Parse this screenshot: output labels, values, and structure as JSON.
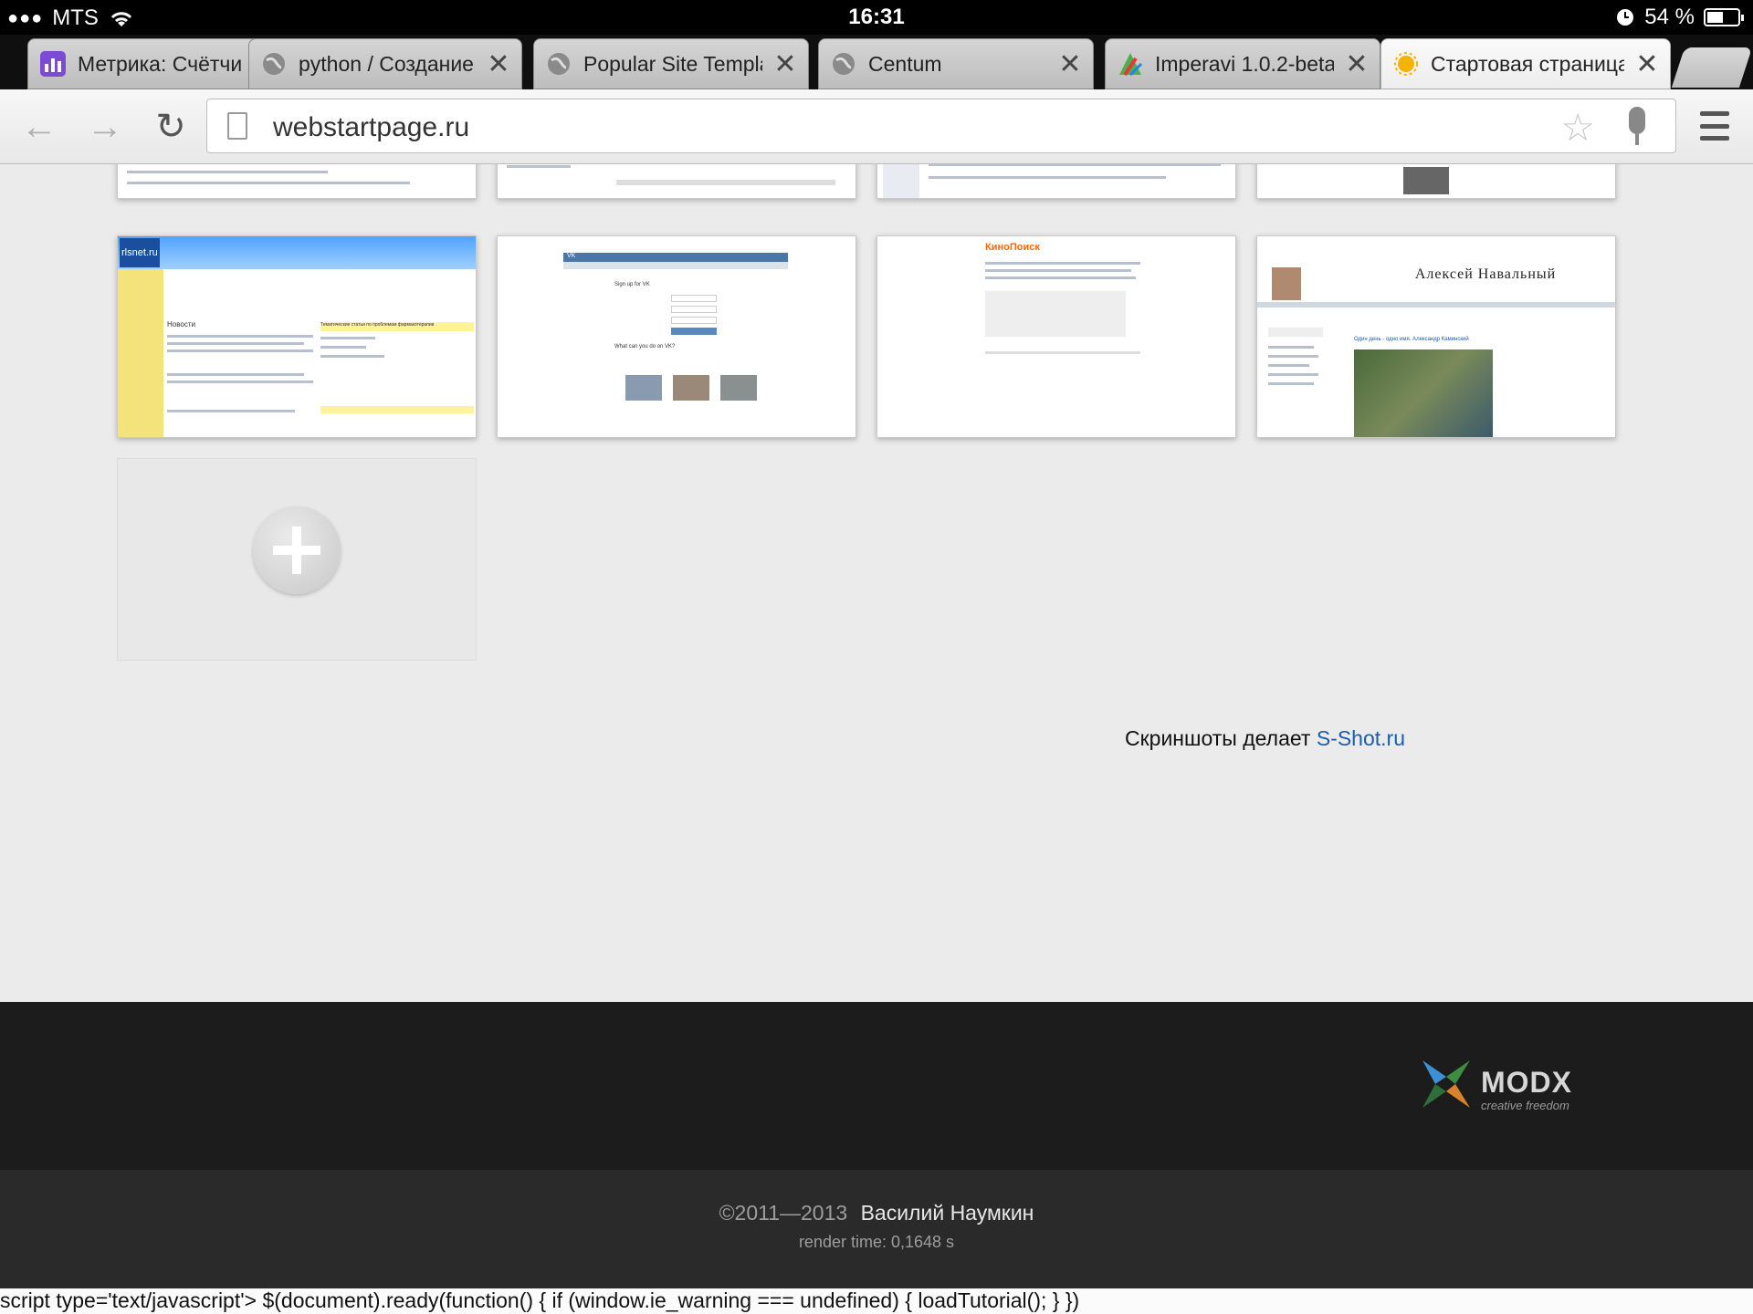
{
  "status_bar": {
    "carrier": "MTS",
    "time": "16:31",
    "battery": "54 %",
    "battery_level": 0.54
  },
  "tabs": [
    {
      "title": "Метрика: Счётчи",
      "favicon": "chart-icon",
      "active": false
    },
    {
      "title": "python / Создание с",
      "favicon": "globe-icon",
      "active": false
    },
    {
      "title": "Popular Site Templat",
      "favicon": "globe-icon",
      "active": false
    },
    {
      "title": "Centum",
      "favicon": "globe-icon",
      "active": false
    },
    {
      "title": "Imperavi 1.0.2-beta |",
      "favicon": "imperavi-icon",
      "active": false
    },
    {
      "title": "Стартовая страница",
      "favicon": "sun-icon",
      "active": true
    }
  ],
  "toolbar": {
    "url": "webstartpage.ru"
  },
  "thumbnails": {
    "row2": [
      {
        "brand": "rlsnet.ru",
        "section1": "Новости",
        "section2": "Тематические статьи по проблемам фармакотерапии"
      },
      {
        "brand": "VK",
        "headline": "Sign up for VK",
        "section": "What can you do on VK?"
      },
      {
        "brand": "КиноПоиск"
      },
      {
        "brand": "Алексей Навальный",
        "post": "Один день - одно имя. Александр Каминский"
      }
    ]
  },
  "credit": {
    "prefix": "Скриншоты делает",
    "link": "S-Shot.ru"
  },
  "footer": {
    "logo_word": "MODX",
    "logo_tagline": "creative freedom",
    "copyright": "©2011—2013",
    "author": "Василий Наумкин",
    "render_time": "render time: 0,1648 s",
    "script_text": "script type='text/javascript'> $(document).ready(function() { if (window.ie_warning === undefined) { loadTutorial(); } })"
  },
  "colors": {
    "link": "#1a5dab",
    "footer_dark": "#1c1c1c",
    "page_bg": "#ebebeb"
  }
}
